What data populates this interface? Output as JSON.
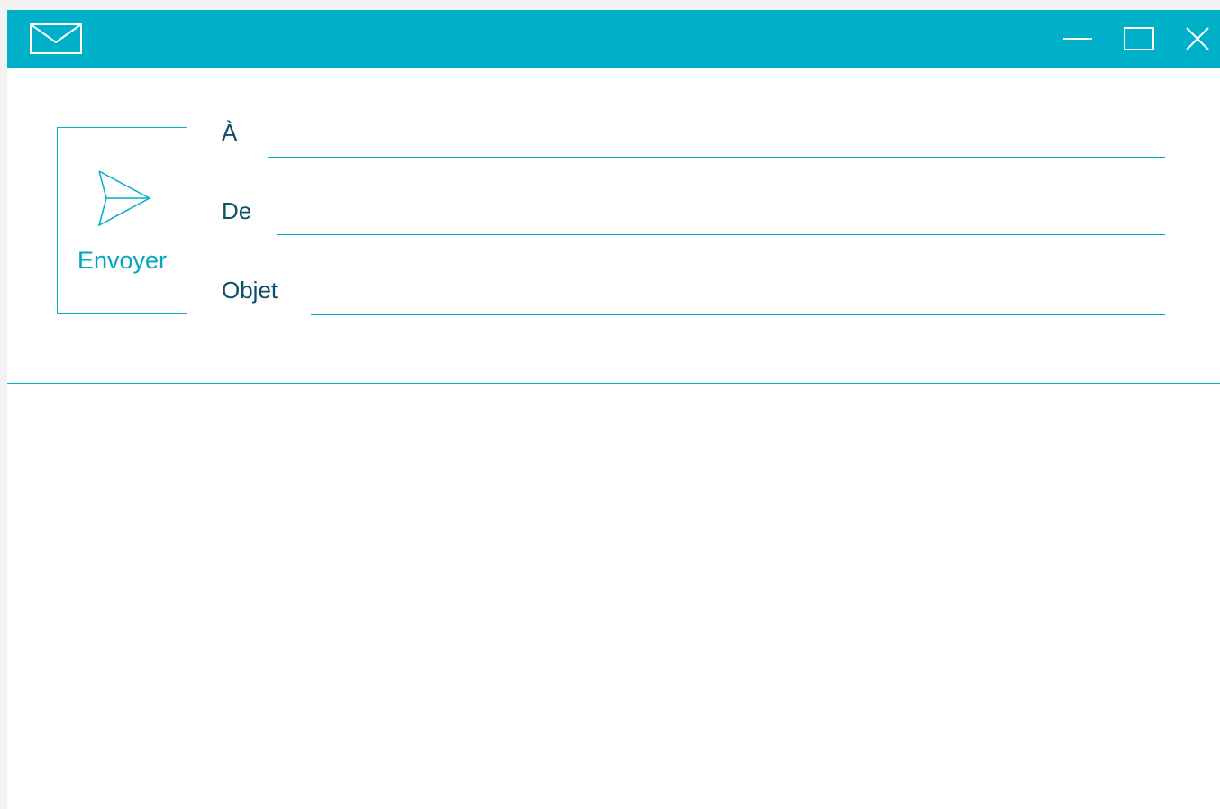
{
  "titlebar": {
    "app_icon": "envelope-icon",
    "controls": {
      "minimize_icon": "minimize-icon",
      "maximize_icon": "maximize-icon",
      "close_icon": "close-icon"
    }
  },
  "compose": {
    "send_button": {
      "label": "Envoyer",
      "icon": "paper-plane-icon"
    },
    "fields": {
      "to": {
        "label": "À",
        "value": ""
      },
      "from": {
        "label": "De",
        "value": ""
      },
      "subject": {
        "label": "Objet",
        "value": ""
      }
    },
    "body": {
      "value": ""
    }
  },
  "colors": {
    "accent": "#00b0c8",
    "label_text": "#0d4f6b",
    "background": "#ffffff"
  }
}
